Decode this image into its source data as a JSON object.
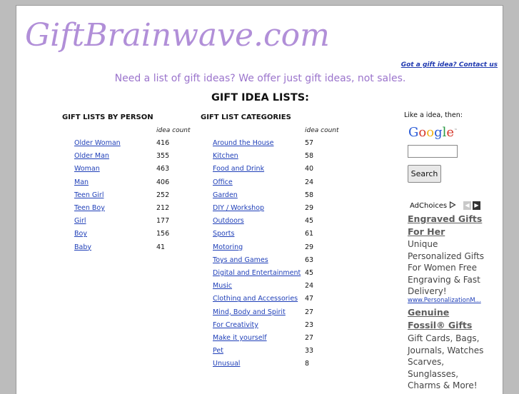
{
  "site": {
    "logo": "GiftBrainwave.com",
    "contact_link": "Got a gift idea? Contact us",
    "tagline": "Need a list of gift ideas? We offer just gift ideas, not sales.",
    "main_title": "GIFT IDEA LISTS:"
  },
  "by_person": {
    "heading": "GIFT LISTS BY PERSON",
    "count_label": "idea count",
    "items": [
      {
        "label": "Older Woman",
        "count": "416"
      },
      {
        "label": "Older Man",
        "count": "355"
      },
      {
        "label": "Woman",
        "count": "463"
      },
      {
        "label": "Man",
        "count": "406"
      },
      {
        "label": "Teen Girl",
        "count": "252"
      },
      {
        "label": "Teen Boy",
        "count": "212"
      },
      {
        "label": "Girl",
        "count": "177"
      },
      {
        "label": "Boy",
        "count": "156"
      },
      {
        "label": "Baby",
        "count": "41"
      }
    ]
  },
  "categories": {
    "heading": "GIFT LIST CATEGORIES",
    "count_label": "idea count",
    "items": [
      {
        "label": "Around the House",
        "count": "57"
      },
      {
        "label": "Kitchen",
        "count": "58"
      },
      {
        "label": "Food and Drink",
        "count": "40"
      },
      {
        "label": "Office",
        "count": "24"
      },
      {
        "label": "Garden",
        "count": "58"
      },
      {
        "label": "DIY / Workshop",
        "count": "29"
      },
      {
        "label": "Outdoors",
        "count": "45"
      },
      {
        "label": "Sports",
        "count": "61"
      },
      {
        "label": "Motoring",
        "count": "29"
      },
      {
        "label": "Toys and Games",
        "count": "63"
      },
      {
        "label": "Digital and Entertainment",
        "count": "45"
      },
      {
        "label": "Music",
        "count": "24"
      },
      {
        "label": "Clothing and Accessories",
        "count": "47"
      },
      {
        "label": "Mind, Body and Spirit",
        "count": "27"
      },
      {
        "label": "For Creativity",
        "count": "23"
      },
      {
        "label": "Make it yourself",
        "count": "27"
      },
      {
        "label": "Pet",
        "count": "33"
      },
      {
        "label": "Unusual",
        "count": "8"
      }
    ]
  },
  "sidebar": {
    "like_text": "Like a idea, then:",
    "google_logo": "Google",
    "search_value": "",
    "search_button": "Search",
    "adchoices": "AdChoices",
    "adchoices_icon": "adchoices-triangle-icon",
    "ads": [
      {
        "title": "Engraved Gifts For Her",
        "body": "Unique Personalized Gifts For Women Free Engraving & Fast Delivery!",
        "url": "www.PersonalizationM..."
      },
      {
        "title": "Genuine Fossil® Gifts",
        "body": "Gift Cards, Bags, Journals, Watches Scarves, Sunglasses, Charms & More!",
        "url": ""
      }
    ]
  },
  "colors": {
    "logo": "#b18fd8",
    "tagline": "#9b74cc",
    "link": "#1f3fb8",
    "ad_title": "#5d5d5d"
  }
}
